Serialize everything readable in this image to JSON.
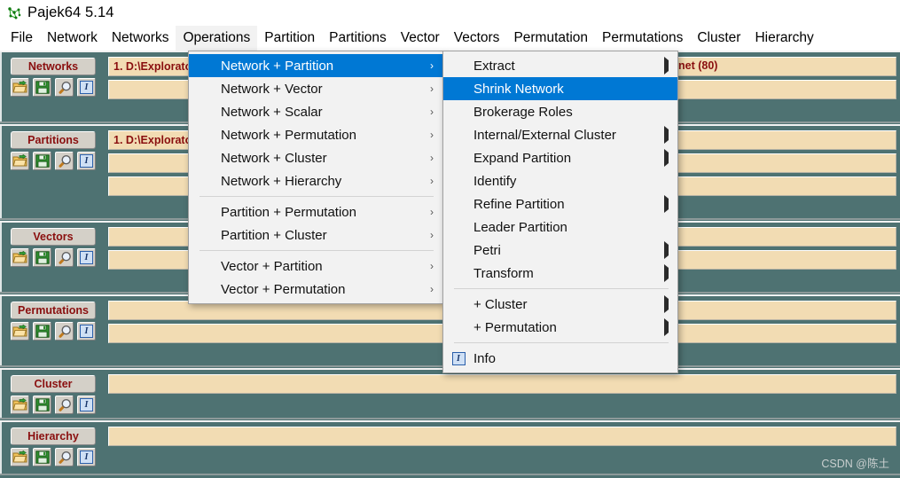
{
  "window": {
    "title": "Pajek64 5.14",
    "icon": "pajek-network-icon"
  },
  "menubar": {
    "items": [
      {
        "label": "File",
        "active": false
      },
      {
        "label": "Network",
        "active": false
      },
      {
        "label": "Networks",
        "active": false
      },
      {
        "label": "Operations",
        "active": true
      },
      {
        "label": "Partition",
        "active": false
      },
      {
        "label": "Partitions",
        "active": false
      },
      {
        "label": "Vector",
        "active": false
      },
      {
        "label": "Vectors",
        "active": false
      },
      {
        "label": "Permutation",
        "active": false
      },
      {
        "label": "Permutations",
        "active": false
      },
      {
        "label": "Cluster",
        "active": false
      },
      {
        "label": "Hierarchy",
        "active": false
      }
    ]
  },
  "panels": [
    {
      "name": "networks",
      "label": "Networks",
      "tools": [
        "open-folder-icon",
        "save-disk-icon",
        "magnifier-icon",
        "info-icon"
      ],
      "fields": [
        {
          "value": "1. D:\\Explorato",
          "empty": false
        },
        {
          "value": "",
          "empty": true
        }
      ]
    },
    {
      "name": "partitions",
      "label": "Partitions",
      "tools": [
        "open-folder-icon",
        "save-disk-icon",
        "magnifier-icon",
        "info-icon"
      ],
      "fields": [
        {
          "value": "1. D:\\Explorato",
          "empty": false
        },
        {
          "value": "",
          "empty": true
        },
        {
          "value": "",
          "empty": true
        }
      ]
    },
    {
      "name": "vectors",
      "label": "Vectors",
      "tools": [
        "open-folder-icon",
        "save-disk-icon",
        "magnifier-icon",
        "info-icon"
      ],
      "fields": [
        {
          "value": "",
          "empty": true
        },
        {
          "value": "",
          "empty": true
        }
      ]
    },
    {
      "name": "permutations",
      "label": "Permutations",
      "tools": [
        "open-folder-icon",
        "save-disk-icon",
        "magnifier-icon",
        "info-icon"
      ],
      "fields": [
        {
          "value": "",
          "empty": true
        },
        {
          "value": "",
          "empty": true
        }
      ]
    },
    {
      "name": "cluster",
      "label": "Cluster",
      "tools": [
        "open-folder-icon",
        "save-disk-icon",
        "magnifier-icon",
        "info-icon"
      ],
      "fields": [
        {
          "value": "",
          "empty": true
        }
      ]
    },
    {
      "name": "hierarchy",
      "label": "Hierarchy",
      "tools": [
        "open-folder-icon",
        "save-disk-icon",
        "magnifier-icon",
        "info-icon"
      ],
      "fields": [
        {
          "value": "",
          "empty": true
        }
      ]
    }
  ],
  "background_text": {
    "networks_field_tail": "net (80)"
  },
  "menu_operations": {
    "items": [
      {
        "label": "Network + Partition",
        "submenu": true,
        "selected": true,
        "separator_after": false
      },
      {
        "label": "Network + Vector",
        "submenu": true,
        "selected": false,
        "separator_after": false
      },
      {
        "label": "Network + Scalar",
        "submenu": true,
        "selected": false,
        "separator_after": false
      },
      {
        "label": "Network + Permutation",
        "submenu": true,
        "selected": false,
        "separator_after": false
      },
      {
        "label": "Network + Cluster",
        "submenu": true,
        "selected": false,
        "separator_after": false
      },
      {
        "label": "Network + Hierarchy",
        "submenu": true,
        "selected": false,
        "separator_after": true
      },
      {
        "label": "Partition + Permutation",
        "submenu": true,
        "selected": false,
        "separator_after": false
      },
      {
        "label": "Partition + Cluster",
        "submenu": true,
        "selected": false,
        "separator_after": true
      },
      {
        "label": "Vector + Partition",
        "submenu": true,
        "selected": false,
        "separator_after": false
      },
      {
        "label": "Vector + Permutation",
        "submenu": true,
        "selected": false,
        "separator_after": false
      }
    ]
  },
  "menu_network_partition": {
    "items": [
      {
        "label": "Extract",
        "icon": "",
        "submenu": true,
        "selected": false,
        "separator_after": false
      },
      {
        "label": "Shrink Network",
        "icon": "",
        "submenu": false,
        "selected": true,
        "separator_after": false
      },
      {
        "label": "Brokerage Roles",
        "icon": "",
        "submenu": false,
        "selected": false,
        "separator_after": false
      },
      {
        "label": "Internal/External Cluster",
        "icon": "",
        "submenu": true,
        "selected": false,
        "separator_after": false
      },
      {
        "label": "Expand Partition",
        "icon": "",
        "submenu": true,
        "selected": false,
        "separator_after": false
      },
      {
        "label": "Identify",
        "icon": "",
        "submenu": false,
        "selected": false,
        "separator_after": false
      },
      {
        "label": "Refine Partition",
        "icon": "",
        "submenu": true,
        "selected": false,
        "separator_after": false
      },
      {
        "label": "Leader Partition",
        "icon": "",
        "submenu": false,
        "selected": false,
        "separator_after": false
      },
      {
        "label": "Petri",
        "icon": "",
        "submenu": true,
        "selected": false,
        "separator_after": false
      },
      {
        "label": "Transform",
        "icon": "",
        "submenu": true,
        "selected": false,
        "separator_after": true
      },
      {
        "label": "+ Cluster",
        "icon": "",
        "submenu": true,
        "selected": false,
        "separator_after": false
      },
      {
        "label": "+ Permutation",
        "icon": "",
        "submenu": true,
        "selected": false,
        "separator_after": true
      },
      {
        "label": "Info",
        "icon": "info-icon",
        "submenu": false,
        "selected": false,
        "separator_after": false
      }
    ]
  },
  "watermark": {
    "text": "CSDN @陈土"
  },
  "colors": {
    "workspace": "#4e7272",
    "field": "#f2dcb3",
    "field_text": "#8a0f0f",
    "selection": "#0078d4",
    "menu_bg": "#f2f2f2",
    "button_face": "#d4d0c8"
  }
}
